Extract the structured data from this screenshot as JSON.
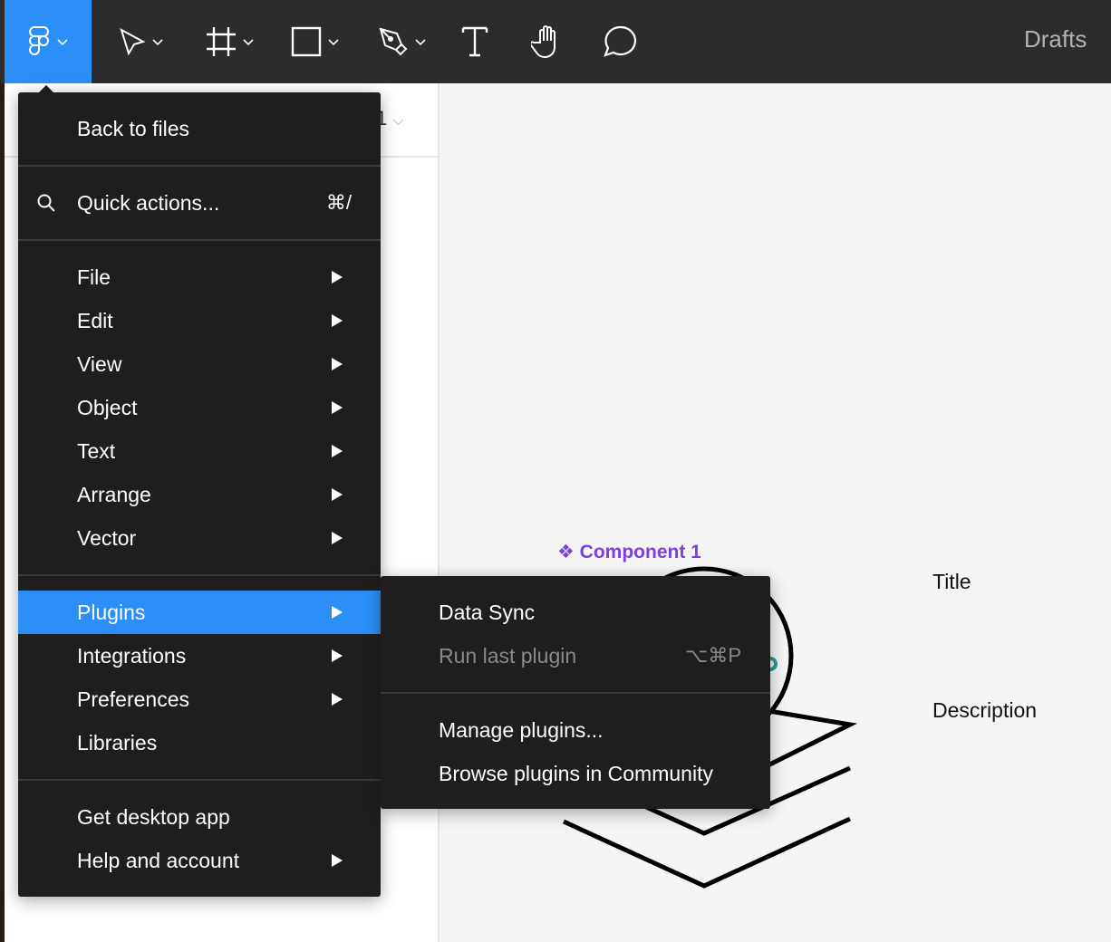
{
  "toolbar": {
    "tools": [
      "main-menu",
      "move",
      "frame",
      "rectangle",
      "pen",
      "text",
      "hand",
      "comment"
    ],
    "breadcrumb": "Drafts",
    "accent": "#2c8ef7"
  },
  "left_panel": {
    "page_selector": "1"
  },
  "main_menu": {
    "back": "Back to files",
    "quick_actions": "Quick actions...",
    "quick_actions_shortcut": "⌘/",
    "items": [
      {
        "label": "File",
        "submenu": true
      },
      {
        "label": "Edit",
        "submenu": true
      },
      {
        "label": "View",
        "submenu": true
      },
      {
        "label": "Object",
        "submenu": true
      },
      {
        "label": "Text",
        "submenu": true
      },
      {
        "label": "Arrange",
        "submenu": true
      },
      {
        "label": "Vector",
        "submenu": true
      }
    ],
    "items2": [
      {
        "label": "Plugins",
        "submenu": true,
        "active": true
      },
      {
        "label": "Integrations",
        "submenu": true
      },
      {
        "label": "Preferences",
        "submenu": true
      },
      {
        "label": "Libraries",
        "submenu": false
      }
    ],
    "items3": [
      {
        "label": "Get desktop app",
        "submenu": false
      },
      {
        "label": "Help and account",
        "submenu": true
      }
    ]
  },
  "plugins_menu": {
    "data_sync": "Data Sync",
    "run_last": "Run last plugin",
    "run_last_shortcut": "⌥⌘P",
    "manage": "Manage plugins...",
    "browse": "Browse plugins in Community"
  },
  "canvas": {
    "component_label": "Component 1",
    "title": "Title",
    "description": "Description",
    "component_color": "#7b3fe4"
  }
}
